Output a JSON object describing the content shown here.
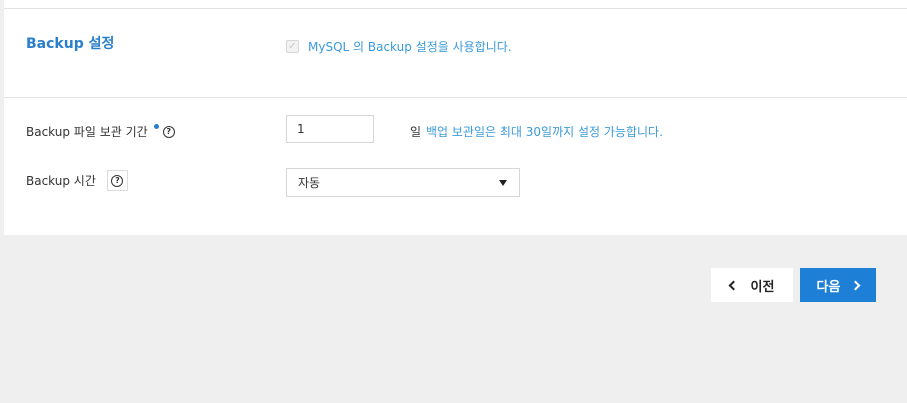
{
  "backup_section": {
    "title": "Backup 설정",
    "checkbox_label": "MySQL 의 Backup 설정을 사용합니다.",
    "checkbox_checked": false
  },
  "retention": {
    "label": "Backup 파일 보관 기간",
    "value": "1",
    "unit": "일",
    "hint": "백업 보관일은 최대 30일까지 설정 가능합니다."
  },
  "backup_time": {
    "label": "Backup 시간",
    "selected": "자동"
  },
  "icons": {
    "help": "?",
    "checkbox_mark": "✓"
  },
  "buttons": {
    "prev": "이전",
    "next": "다음"
  },
  "colors": {
    "accent": "#2a7fcc",
    "link_text": "#3a9ad9",
    "primary_button": "#1e7fd6",
    "background": "#efefef"
  }
}
